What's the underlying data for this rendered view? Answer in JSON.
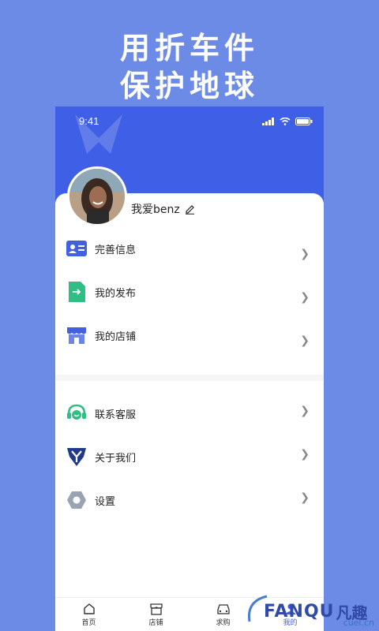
{
  "headline": {
    "line1": "用折车件",
    "line2": "保护地球"
  },
  "status_bar": {
    "time": "9:41"
  },
  "profile": {
    "username": "我爱benz"
  },
  "menu_group1": [
    {
      "label": "完善信息",
      "icon": "id-card-icon"
    },
    {
      "label": "我的发布",
      "icon": "document-publish-icon"
    },
    {
      "label": "我的店铺",
      "icon": "store-icon"
    }
  ],
  "menu_group2": [
    {
      "label": "联系客服",
      "icon": "headset-icon"
    },
    {
      "label": "关于我们",
      "icon": "brand-logo-icon"
    },
    {
      "label": "设置",
      "icon": "settings-hex-icon"
    }
  ],
  "bottom_nav": [
    {
      "label": "首页",
      "icon": "home-icon"
    },
    {
      "label": "店铺",
      "icon": "shop-icon"
    },
    {
      "label": "求购",
      "icon": "car-icon"
    },
    {
      "label": "我的",
      "icon": "user-icon"
    }
  ],
  "watermark": {
    "brand": "FANQU",
    "brand_cn": "凡趣",
    "site": "cuel.cn"
  },
  "colors": {
    "primary": "#3f5fe6",
    "background": "#6b8be6",
    "green": "#2fbf84",
    "icon_blue": "#4260e0"
  }
}
